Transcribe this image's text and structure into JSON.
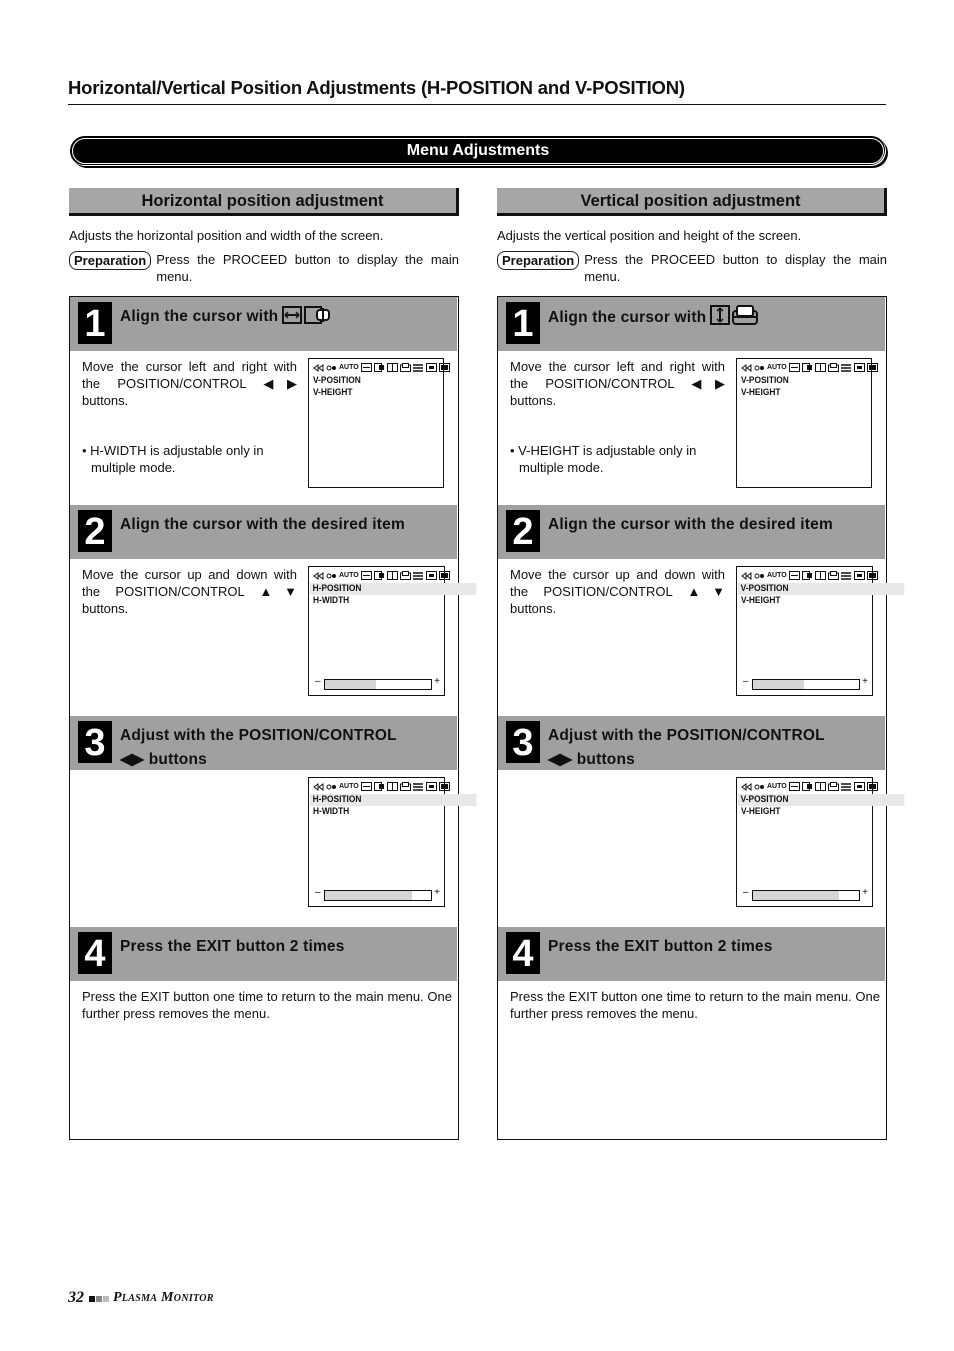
{
  "page": {
    "title": "Horizontal/Vertical Position Adjustments (H-POSITION and V-POSITION)",
    "banner": "Menu Adjustments",
    "footer": {
      "page_number": "32",
      "brand": "Plasma Monitor"
    }
  },
  "columns": [
    {
      "heading": "Horizontal position adjustment",
      "intro": "Adjusts the horizontal position and width of the screen.",
      "preparation": {
        "badge": "Preparation",
        "text": "Press the PROCEED button to display the main menu."
      },
      "steps": [
        {
          "number": "1",
          "title": "Align the cursor with",
          "title_icons": [
            "h-position-icon",
            "h-width-icon"
          ],
          "body": "Move the cursor left and right with the POSITION/CONTROL ◀▶ buttons.",
          "note": "• H-WIDTH is adjustable only in multiple mode.",
          "osd": {
            "items": [
              "V-POSITION",
              "V-HEIGHT"
            ],
            "selected": null,
            "slider_percent": null
          }
        },
        {
          "number": "2",
          "title": "Align the cursor with the desired item",
          "body": "Move the cursor up and down with the POSITION/CONTROL ▲▼ buttons.",
          "osd": {
            "items": [
              "H-POSITION",
              "H-WIDTH"
            ],
            "selected": 0,
            "slider_percent": 48
          }
        },
        {
          "number": "3",
          "title": "Adjust with the POSITION/CONTROL",
          "title_line2": "◀▶ buttons",
          "osd": {
            "items": [
              "H-POSITION",
              "H-WIDTH"
            ],
            "selected": 0,
            "slider_percent": 82
          }
        },
        {
          "number": "4",
          "title": "Press the EXIT button 2 times",
          "body": "Press the EXIT button one time to return to the main menu. One further press removes the menu."
        }
      ]
    },
    {
      "heading": "Vertical position adjustment",
      "intro": "Adjusts the vertical position and height of the screen.",
      "preparation": {
        "badge": "Preparation",
        "text": "Press the PROCEED button to display the main menu."
      },
      "steps": [
        {
          "number": "1",
          "title": "Align the cursor with",
          "title_icons": [
            "v-position-icon",
            "v-height-icon"
          ],
          "body": "Move the cursor left and right with the POSITION/CONTROL ◀▶ buttons.",
          "note": "• V-HEIGHT is adjustable only in multiple mode.",
          "osd": {
            "items": [
              "V-POSITION",
              "V-HEIGHT"
            ],
            "selected": null,
            "slider_percent": null
          }
        },
        {
          "number": "2",
          "title": "Align the cursor with the desired item",
          "body": "Move the cursor up and down with the POSITION/CONTROL ▲▼ buttons.",
          "osd": {
            "items": [
              "V-POSITION",
              "V-HEIGHT"
            ],
            "selected": 0,
            "slider_percent": 48
          }
        },
        {
          "number": "3",
          "title": "Adjust with the POSITION/CONTROL",
          "title_line2": "◀▶ buttons",
          "osd": {
            "items": [
              "V-POSITION",
              "V-HEIGHT"
            ],
            "selected": 0,
            "slider_percent": 81
          }
        },
        {
          "number": "4",
          "title": "Press the EXIT button 2 times",
          "body": "Press the EXIT button one time to return to the main menu. One further press removes the menu."
        }
      ]
    }
  ],
  "osd_menu_bar": {
    "icons": [
      "volume-icon",
      "audio-icon",
      "auto-label",
      "h-position-icon",
      "h-width-icon",
      "v-position-icon",
      "v-height-icon",
      "settings-icon",
      "screen-icon",
      "mode-icon"
    ],
    "auto_label": "AUTO"
  }
}
